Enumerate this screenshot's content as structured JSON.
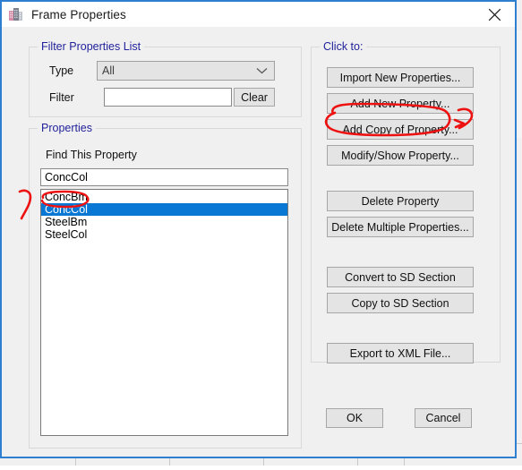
{
  "window": {
    "title": "Frame Properties",
    "icon": "building-icon",
    "close_label": "×",
    "border_color": "#2f7fd0"
  },
  "filter_group": {
    "title": "Filter Properties List",
    "type_label": "Type",
    "type_value": "All",
    "filter_label": "Filter",
    "filter_value": "",
    "clear_label": "Clear"
  },
  "properties_group": {
    "title": "Properties",
    "find_label": "Find This Property",
    "find_value": "ConcCol",
    "items": [
      {
        "label": "ConcBm",
        "selected": false
      },
      {
        "label": "ConcCol",
        "selected": true
      },
      {
        "label": "SteelBm",
        "selected": false
      },
      {
        "label": "SteelCol",
        "selected": false
      }
    ],
    "selection_color": "#0878d4"
  },
  "click_to_group": {
    "title": "Click to:",
    "buttons": [
      {
        "label": "Import New Properties...",
        "group": 1
      },
      {
        "label": "Add New Property...",
        "group": 1
      },
      {
        "label": "Add Copy of Property...",
        "group": 1,
        "highlighted": true
      },
      {
        "label": "Modify/Show Property...",
        "group": 1
      },
      {
        "label": "Delete Property",
        "group": 2
      },
      {
        "label": "Delete Multiple Properties...",
        "group": 2
      },
      {
        "label": "Convert to SD Section",
        "group": 3
      },
      {
        "label": "Copy to SD Section",
        "group": 3
      },
      {
        "label": "Export to XML File...",
        "group": 4
      }
    ]
  },
  "footer": {
    "ok_label": "OK",
    "cancel_label": "Cancel"
  },
  "annotations": {
    "ink_color": "#ee1111",
    "marks": [
      {
        "name": "ellipse-around-add-copy-of-property"
      },
      {
        "name": "arrow-right-of-add-copy-of-property"
      },
      {
        "name": "ellipse-around-conccol-list-item"
      },
      {
        "name": "arrow-left-of-conccol-list-item"
      }
    ]
  }
}
